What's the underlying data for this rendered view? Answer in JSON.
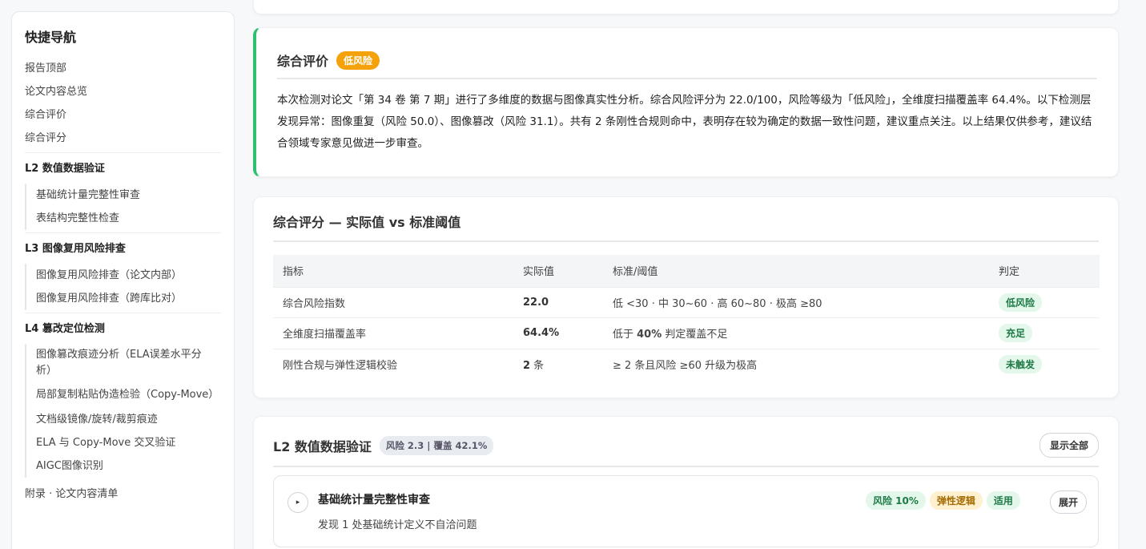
{
  "nav": {
    "title": "快捷导航",
    "top_links": [
      "报告顶部",
      "论文内容总览",
      "综合评价",
      "综合评分"
    ],
    "groups": [
      {
        "title": "L2 数值数据验证",
        "items": [
          "基础统计量完整性审查",
          "表结构完整性检查"
        ]
      },
      {
        "title": "L3 图像复用风险排查",
        "items": [
          "图像复用风险排查（论文内部）",
          "图像复用风险排查（跨库比对）"
        ]
      },
      {
        "title": "L4 篡改定位检测",
        "items": [
          "图像篡改痕迹分析（ELA误差水平分析）",
          "局部复制粘贴伪造检验（Copy-Move）",
          "文档级镜像/旋转/裁剪痕迹",
          "ELA 与 Copy-Move 交叉验证",
          "AIGC图像识别"
        ]
      }
    ],
    "appendix": "附录 · 论文内容清单"
  },
  "summary": {
    "title": "综合评价",
    "badge": "低风险",
    "text": "本次检测对论文「第 34 卷 第 7 期」进行了多维度的数据与图像真实性分析。综合风险评分为 22.0/100，风险等级为「低风险」，全维度扫描覆盖率 64.4%。以下检测层发现异常：图像重复（风险 50.0）、图像篡改（风险 31.1）。共有 2 条刚性合规则命中，表明存在较为确定的数据一致性问题，建议重点关注。以上结果仅供参考，建议结合领域专家意见做进一步审查。"
  },
  "score": {
    "title": "综合评分 — 实际值 vs 标准阈值",
    "headers": [
      "指标",
      "实际值",
      "标准/阈值",
      "判定"
    ],
    "rows": [
      {
        "metric": "综合风险指数",
        "value": "22.0",
        "unit": "",
        "threshold": "低 <30 · 中 30~60 · 高 60~80 · 极高 ≥80",
        "verdict": "低风险"
      },
      {
        "metric": "全维度扫描覆盖率",
        "value": "64.4%",
        "unit": "",
        "threshold": "低于 40% 判定覆盖不足",
        "verdict": "充足"
      },
      {
        "metric": "刚性合规与弹性逻辑校验",
        "value": "2",
        "unit": " 条",
        "threshold": "≥ 2 条且风险 ≥60 升级为极高",
        "verdict": "未触发"
      }
    ]
  },
  "l2": {
    "title": "L2 数值数据验证",
    "badge": "风险 2.3 | 覆盖 42.1%",
    "show_all": "显示全部",
    "item": {
      "play": "▸",
      "title": "基础统计量完整性审查",
      "desc": "发现 1 处基础统计定义不自洽问题",
      "tags": [
        "风险 10%",
        "弹性逻辑",
        "适用"
      ],
      "expand": "展开"
    }
  }
}
